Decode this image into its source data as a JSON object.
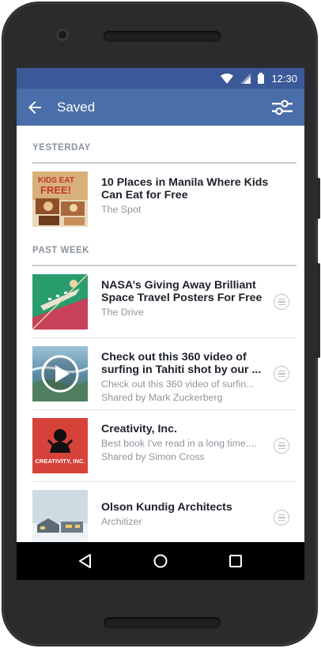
{
  "status_bar": {
    "time": "12:30",
    "icons": [
      "wifi-icon",
      "signal-icon",
      "battery-icon"
    ]
  },
  "app_bar": {
    "title": "Saved",
    "icons": [
      "back-arrow-icon",
      "filter-icon"
    ]
  },
  "sections": [
    {
      "header": "YESTERDAY",
      "items": [
        {
          "title": "10 Places in Manila Where Kids Can Eat for Free",
          "line1": "The Spot",
          "line2": "",
          "has_more_button": false
        }
      ]
    },
    {
      "header": "PAST WEEK",
      "items": [
        {
          "title": "NASA’s Giving Away Brilliant Space Travel Posters For Free",
          "line1": "The Drive",
          "line2": "",
          "has_more_button": true
        },
        {
          "title": "Check out this 360 video of surfing in Tahiti shot by our ...",
          "line1": "Check out this 360 video of surfin...",
          "line2": "Shared by Mark Zuckerberg",
          "has_more_button": true
        },
        {
          "title": "Creativity, Inc.",
          "line1": "Best book I've read in a long time....",
          "line2": "Shared by Simon Cross",
          "has_more_button": true
        },
        {
          "title": "Olson Kundig Architects",
          "line1": "Architizer",
          "line2": "",
          "has_more_button": true
        }
      ]
    }
  ],
  "thumbnails": {
    "kids_eat_free": [
      "KIDS EAT",
      "FREE!"
    ],
    "creativity_inc": "CREATIVITY, INC."
  },
  "nav_bar": {
    "icons": [
      "back-triangle-icon",
      "home-circle-icon",
      "recents-square-icon"
    ]
  },
  "colors": {
    "status_bar": "#3b5998",
    "app_bar": "#4a6ea9",
    "title_text": "#1d2129",
    "meta_text": "#90949c"
  }
}
